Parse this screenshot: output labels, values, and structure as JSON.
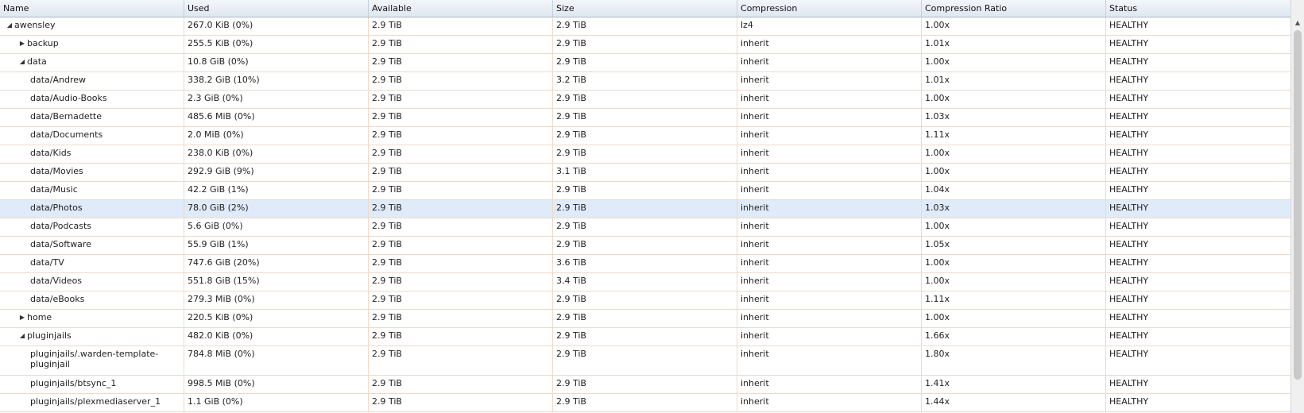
{
  "columns": [
    "Name",
    "Used",
    "Available",
    "Size",
    "Compression",
    "Compression Ratio",
    "Status"
  ],
  "rows": [
    {
      "name": "awensley",
      "used": "267.0 KiB (0%)",
      "available": "2.9 TiB",
      "size": "2.9 TiB",
      "compression": "lz4",
      "ratio": "1.00x",
      "status": "HEALTHY",
      "level": 0,
      "toggle": "expanded"
    },
    {
      "name": "backup",
      "used": "255.5 KiB (0%)",
      "available": "2.9 TiB",
      "size": "2.9 TiB",
      "compression": "inherit",
      "ratio": "1.01x",
      "status": "HEALTHY",
      "level": 1,
      "toggle": "collapsed"
    },
    {
      "name": "data",
      "used": "10.8 GiB (0%)",
      "available": "2.9 TiB",
      "size": "2.9 TiB",
      "compression": "inherit",
      "ratio": "1.00x",
      "status": "HEALTHY",
      "level": 1,
      "toggle": "expanded"
    },
    {
      "name": "data/Andrew",
      "used": "338.2 GiB (10%)",
      "available": "2.9 TiB",
      "size": "3.2 TiB",
      "compression": "inherit",
      "ratio": "1.01x",
      "status": "HEALTHY",
      "level": 2
    },
    {
      "name": "data/Audio-Books",
      "used": "2.3 GiB (0%)",
      "available": "2.9 TiB",
      "size": "2.9 TiB",
      "compression": "inherit",
      "ratio": "1.00x",
      "status": "HEALTHY",
      "level": 2
    },
    {
      "name": "data/Bernadette",
      "used": "485.6 MiB (0%)",
      "available": "2.9 TiB",
      "size": "2.9 TiB",
      "compression": "inherit",
      "ratio": "1.03x",
      "status": "HEALTHY",
      "level": 2
    },
    {
      "name": "data/Documents",
      "used": "2.0 MiB (0%)",
      "available": "2.9 TiB",
      "size": "2.9 TiB",
      "compression": "inherit",
      "ratio": "1.11x",
      "status": "HEALTHY",
      "level": 2
    },
    {
      "name": "data/Kids",
      "used": "238.0 KiB (0%)",
      "available": "2.9 TiB",
      "size": "2.9 TiB",
      "compression": "inherit",
      "ratio": "1.00x",
      "status": "HEALTHY",
      "level": 2
    },
    {
      "name": "data/Movies",
      "used": "292.9 GiB (9%)",
      "available": "2.9 TiB",
      "size": "3.1 TiB",
      "compression": "inherit",
      "ratio": "1.00x",
      "status": "HEALTHY",
      "level": 2
    },
    {
      "name": "data/Music",
      "used": "42.2 GiB (1%)",
      "available": "2.9 TiB",
      "size": "2.9 TiB",
      "compression": "inherit",
      "ratio": "1.04x",
      "status": "HEALTHY",
      "level": 2
    },
    {
      "name": "data/Photos",
      "used": "78.0 GiB (2%)",
      "available": "2.9 TiB",
      "size": "2.9 TiB",
      "compression": "inherit",
      "ratio": "1.03x",
      "status": "HEALTHY",
      "level": 2,
      "selected": true
    },
    {
      "name": "data/Podcasts",
      "used": "5.6 GiB (0%)",
      "available": "2.9 TiB",
      "size": "2.9 TiB",
      "compression": "inherit",
      "ratio": "1.00x",
      "status": "HEALTHY",
      "level": 2
    },
    {
      "name": "data/Software",
      "used": "55.9 GiB (1%)",
      "available": "2.9 TiB",
      "size": "2.9 TiB",
      "compression": "inherit",
      "ratio": "1.05x",
      "status": "HEALTHY",
      "level": 2
    },
    {
      "name": "data/TV",
      "used": "747.6 GiB (20%)",
      "available": "2.9 TiB",
      "size": "3.6 TiB",
      "compression": "inherit",
      "ratio": "1.00x",
      "status": "HEALTHY",
      "level": 2
    },
    {
      "name": "data/Videos",
      "used": "551.8 GiB (15%)",
      "available": "2.9 TiB",
      "size": "3.4 TiB",
      "compression": "inherit",
      "ratio": "1.00x",
      "status": "HEALTHY",
      "level": 2
    },
    {
      "name": "data/eBooks",
      "used": "279.3 MiB (0%)",
      "available": "2.9 TiB",
      "size": "2.9 TiB",
      "compression": "inherit",
      "ratio": "1.11x",
      "status": "HEALTHY",
      "level": 2
    },
    {
      "name": "home",
      "used": "220.5 KiB (0%)",
      "available": "2.9 TiB",
      "size": "2.9 TiB",
      "compression": "inherit",
      "ratio": "1.00x",
      "status": "HEALTHY",
      "level": 1,
      "toggle": "collapsed"
    },
    {
      "name": "pluginjails",
      "used": "482.0 KiB (0%)",
      "available": "2.9 TiB",
      "size": "2.9 TiB",
      "compression": "inherit",
      "ratio": "1.66x",
      "status": "HEALTHY",
      "level": 1,
      "toggle": "expanded"
    },
    {
      "name": "pluginjails/.warden-template-pluginjail",
      "used": "784.8 MiB (0%)",
      "available": "2.9 TiB",
      "size": "2.9 TiB",
      "compression": "inherit",
      "ratio": "1.80x",
      "status": "HEALTHY",
      "level": 2,
      "wrap": true
    },
    {
      "name": "pluginjails/btsync_1",
      "used": "998.5 MiB (0%)",
      "available": "2.9 TiB",
      "size": "2.9 TiB",
      "compression": "inherit",
      "ratio": "1.41x",
      "status": "HEALTHY",
      "level": 2
    },
    {
      "name": "pluginjails/plexmediaserver_1",
      "used": "1.1 GiB (0%)",
      "available": "2.9 TiB",
      "size": "2.9 TiB",
      "compression": "inherit",
      "ratio": "1.44x",
      "status": "HEALTHY",
      "level": 2
    }
  ],
  "icons": {
    "expanded": "triangle-down-icon",
    "collapsed": "triangle-right-icon",
    "scroll_up": "scroll-up-arrow-icon"
  },
  "colors": {
    "selected_row": "#dfebf8",
    "row_border": "#f0d9c8",
    "header_bg": "#dfe7f1"
  }
}
